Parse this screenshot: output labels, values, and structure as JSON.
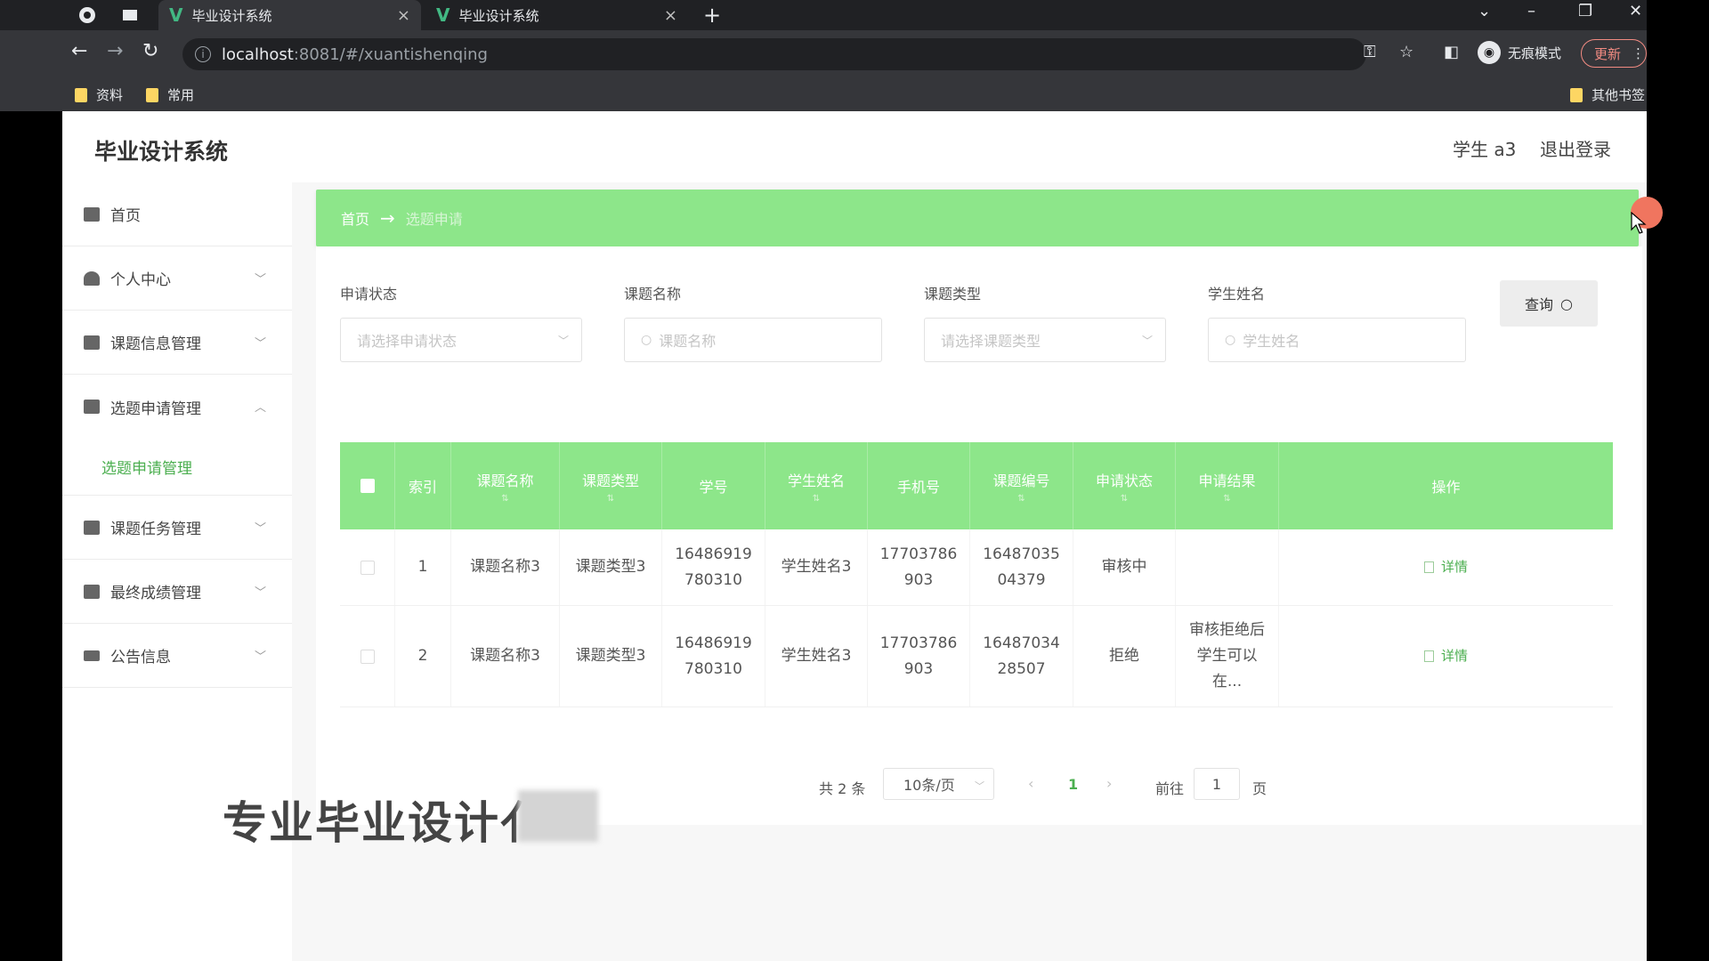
{
  "browser": {
    "tabs": [
      {
        "title": "毕业设计系统",
        "active": true
      },
      {
        "title": "毕业设计系统",
        "active": false
      }
    ],
    "url_host": "localhost",
    "url_path": ":8081/#/xuantishenqing",
    "incognito_label": "无痕模式",
    "update_label": "更新",
    "bookmarks": [
      "资料",
      "常用"
    ],
    "other_bookmarks": "其他书签"
  },
  "app": {
    "title": "毕业设计系统",
    "user": "学生 a3",
    "logout": "退出登录"
  },
  "sidebar": {
    "items": [
      {
        "label": "首页",
        "icon": "home-icon",
        "expandable": false
      },
      {
        "label": "个人中心",
        "icon": "user-icon",
        "expandable": true
      },
      {
        "label": "课题信息管理",
        "icon": "topic-icon",
        "expandable": true
      },
      {
        "label": "选题申请管理",
        "icon": "briefcase-icon",
        "expandable": true,
        "expanded": true
      },
      {
        "label": "课题任务管理",
        "icon": "task-icon",
        "expandable": true
      },
      {
        "label": "最终成绩管理",
        "icon": "grade-icon",
        "expandable": true
      },
      {
        "label": "公告信息",
        "icon": "notice-icon",
        "expandable": true
      }
    ],
    "submenu_label": "选题申请管理"
  },
  "breadcrumb": {
    "home": "首页",
    "separator": "→",
    "current": "选题申请"
  },
  "filters": {
    "status": {
      "label": "申请状态",
      "placeholder": "请选择申请状态"
    },
    "topic_name": {
      "label": "课题名称",
      "placeholder": "课题名称"
    },
    "topic_type": {
      "label": "课题类型",
      "placeholder": "请选择课题类型"
    },
    "student_name": {
      "label": "学生姓名",
      "placeholder": "学生姓名"
    },
    "query_button": "查询"
  },
  "table": {
    "headers": [
      "索引",
      "课题名称",
      "课题类型",
      "学号",
      "学生姓名",
      "手机号",
      "课题编号",
      "申请状态",
      "申请结果",
      "操作"
    ],
    "rows": [
      {
        "index": "1",
        "topic_name": "课题名称3",
        "topic_type": "课题类型3",
        "student_id_1": "16486919",
        "student_id_2": "780310",
        "student_name": "学生姓名3",
        "phone_1": "17703786",
        "phone_2": "903",
        "topic_no_1": "16487035",
        "topic_no_2": "04379",
        "status": "审核中",
        "result_1": "",
        "result_2": "",
        "result_3": "",
        "action": "详情"
      },
      {
        "index": "2",
        "topic_name": "课题名称3",
        "topic_type": "课题类型3",
        "student_id_1": "16486919",
        "student_id_2": "780310",
        "student_name": "学生姓名3",
        "phone_1": "17703786",
        "phone_2": "903",
        "topic_no_1": "16487034",
        "topic_no_2": "28507",
        "status": "拒绝",
        "result_1": "审核拒绝后",
        "result_2": "学生可以",
        "result_3": "在...",
        "action": "详情"
      }
    ]
  },
  "pagination": {
    "total": "共 2 条",
    "page_size": "10条/页",
    "prev": "‹",
    "current": "1",
    "next": "›",
    "goto_label": "前往",
    "goto_value": "1",
    "page_suffix": "页"
  },
  "overlay": {
    "text": "专业毕业设计亻"
  }
}
